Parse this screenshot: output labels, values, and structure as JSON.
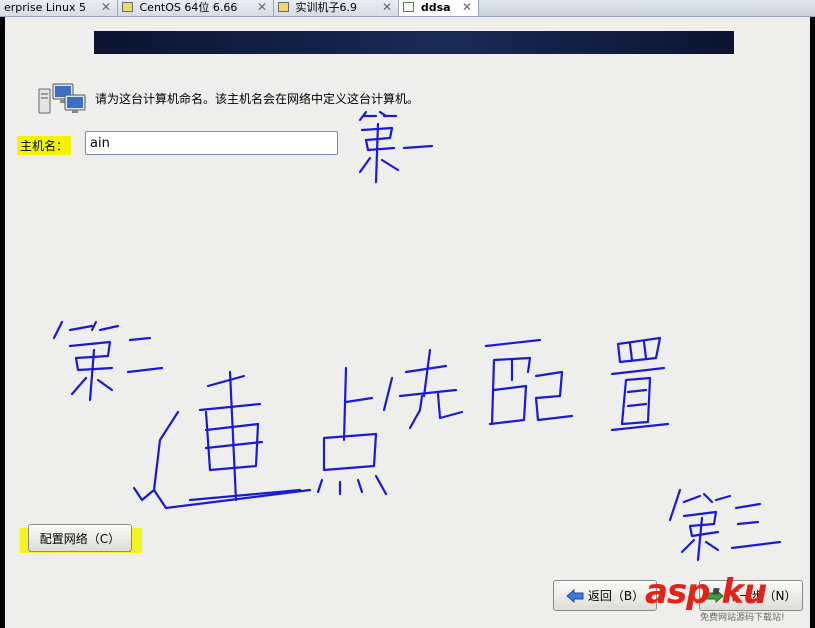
{
  "tabs": [
    {
      "label": "erprise Linux 5",
      "active": false
    },
    {
      "label": "CentOS 64位 6.66",
      "active": false
    },
    {
      "label": "实训机子6.9",
      "active": false
    },
    {
      "label": "ddsa",
      "active": true
    }
  ],
  "tab_close_glyph": "✕",
  "installer": {
    "instruction": "请为这台计算机命名。该主机名会在网络中定义这台计算机。",
    "hostname_label": "主机名：",
    "hostname_value": "ain",
    "configure_network_button": "配置网络（C）",
    "back_button": "返回（B）",
    "next_button": "下一步（N）"
  },
  "annotations": {
    "step_one": "第一",
    "step_two": "第二",
    "step_three": "第三",
    "key_point": "重点先配置"
  },
  "watermark": {
    "brand": "asp",
    "brand_dot": "·",
    "brand_suffix": "ku",
    "tagline": "免费网站源码下载站!"
  },
  "colors": {
    "highlight": "#f4f400",
    "ink": "#1a1ad6",
    "banner": "#0b1430",
    "watermark": "#e2231a"
  }
}
